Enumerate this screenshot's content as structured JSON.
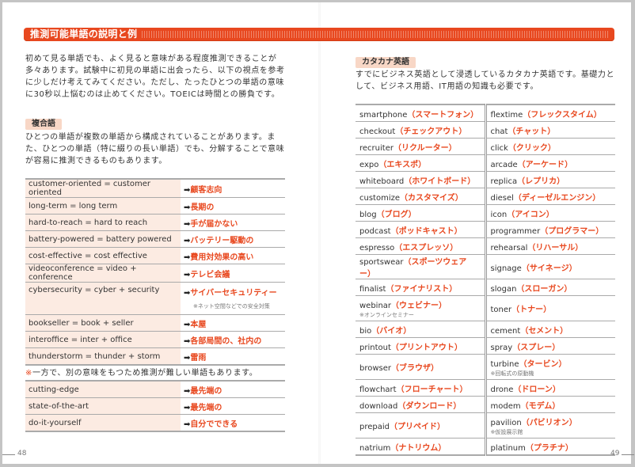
{
  "section_title": "推測可能単語の説明と例",
  "left_page": {
    "intro": "初めて見る単語でも、よく見ると意味がある程度推測できることが多々あります。試験中に初見の単語に出会ったら、以下の視点を参考に少しだけ考えてみてください。ただし、たったひとつの単語の意味に30秒以上悩むのは止めてください。TOEICは時間との勝負です。",
    "compound_tag": "複合語",
    "compound_desc": "ひとつの単語が複数の単語から構成されていることがあります。また、ひとつの単語（特に綴りの長い単語）でも、分解することで意味が容易に推測できるものもあります。",
    "compound_rows": [
      {
        "en": "customer-oriented = customer oriented",
        "jp": "顧客志向",
        "note": ""
      },
      {
        "en": "long-term = long term",
        "jp": "長期の",
        "note": ""
      },
      {
        "en": "hard-to-reach = hard to reach",
        "jp": "手が届かない",
        "note": ""
      },
      {
        "en": "battery-powered = battery powered",
        "jp": "バッテリー駆動の",
        "note": ""
      },
      {
        "en": "cost-effective = cost effective",
        "jp": "費用対効果の高い",
        "note": ""
      },
      {
        "en": "videoconference = video + conference",
        "jp": "テレビ会議",
        "note": ""
      },
      {
        "en": "cybersecurity = cyber + security",
        "jp": "サイバーセキュリティー",
        "note": "※ネット空間などでの安全対策"
      },
      {
        "en": "bookseller = book + seller",
        "jp": "本屋",
        "note": ""
      },
      {
        "en": "interoffice = inter + office",
        "jp": "各部局間の、社内の",
        "note": ""
      },
      {
        "en": "thunderstorm = thunder + storm",
        "jp": "雷雨",
        "note": ""
      }
    ],
    "arrow": "➡",
    "caution_mark": "※",
    "caution_text": "一方で、別の意味をもつため推測が難しい単語もあります。",
    "caution_rows": [
      {
        "en": "cutting-edge",
        "jp": "最先端の"
      },
      {
        "en": "state-of-the-art",
        "jp": "最先端の"
      },
      {
        "en": "do-it-yourself",
        "jp": "自分でできる"
      }
    ],
    "page_number": "48"
  },
  "right_page": {
    "katakana_tag": "カタカナ英語",
    "katakana_desc": "すでにビジネス英語として浸透しているカタカナ英語です。基礎力として、ビジネス用語、IT用語の知識も必要です。",
    "rows": [
      [
        {
          "en": "smartphone",
          "kana": "スマートフォン",
          "note": ""
        },
        {
          "en": "flextime",
          "kana": "フレックスタイム",
          "note": ""
        }
      ],
      [
        {
          "en": "checkout",
          "kana": "チェックアウト",
          "note": ""
        },
        {
          "en": "chat",
          "kana": "チャット",
          "note": ""
        }
      ],
      [
        {
          "en": "recruiter",
          "kana": "リクルーター",
          "note": ""
        },
        {
          "en": "click",
          "kana": "クリック",
          "note": ""
        }
      ],
      [
        {
          "en": "expo",
          "kana": "エキスポ",
          "note": ""
        },
        {
          "en": "arcade",
          "kana": "アーケード",
          "note": ""
        }
      ],
      [
        {
          "en": "whiteboard",
          "kana": "ホワイトボード",
          "note": ""
        },
        {
          "en": "replica",
          "kana": "レプリカ",
          "note": ""
        }
      ],
      [
        {
          "en": "customize",
          "kana": "カスタマイズ",
          "note": ""
        },
        {
          "en": "diesel",
          "kana": "ディーゼルエンジン",
          "note": ""
        }
      ],
      [
        {
          "en": "blog",
          "kana": "ブログ",
          "note": ""
        },
        {
          "en": "icon",
          "kana": "アイコン",
          "note": ""
        }
      ],
      [
        {
          "en": "podcast",
          "kana": "ポッドキャスト",
          "note": ""
        },
        {
          "en": "programmer",
          "kana": "プログラマー",
          "note": ""
        }
      ],
      [
        {
          "en": "espresso",
          "kana": "エスプレッソ",
          "note": ""
        },
        {
          "en": "rehearsal",
          "kana": "リハーサル",
          "note": ""
        }
      ],
      [
        {
          "en": "sportswear",
          "kana": "スポーツウェアー",
          "note": ""
        },
        {
          "en": "signage",
          "kana": "サイネージ",
          "note": ""
        }
      ],
      [
        {
          "en": "finalist",
          "kana": "ファイナリスト",
          "note": ""
        },
        {
          "en": "slogan",
          "kana": "スローガン",
          "note": ""
        }
      ],
      [
        {
          "en": "webinar",
          "kana": "ウェビナー",
          "note": "※オンラインセミナー"
        },
        {
          "en": "toner",
          "kana": "トナー",
          "note": ""
        }
      ],
      [
        {
          "en": "bio",
          "kana": "バイオ",
          "note": ""
        },
        {
          "en": "cement",
          "kana": "セメント",
          "note": ""
        }
      ],
      [
        {
          "en": "printout",
          "kana": "プリントアウト",
          "note": ""
        },
        {
          "en": "spray",
          "kana": "スプレー",
          "note": ""
        }
      ],
      [
        {
          "en": "browser",
          "kana": "ブラウザ",
          "note": ""
        },
        {
          "en": "turbine",
          "kana": "タービン",
          "note": "※回転式の原動機"
        }
      ],
      [
        {
          "en": "flowchart",
          "kana": "フローチャート",
          "note": ""
        },
        {
          "en": "drone",
          "kana": "ドローン",
          "note": ""
        }
      ],
      [
        {
          "en": "download",
          "kana": "ダウンロード",
          "note": ""
        },
        {
          "en": "modem",
          "kana": "モデム",
          "note": ""
        }
      ],
      [
        {
          "en": "prepaid",
          "kana": "プリペイド",
          "note": ""
        },
        {
          "en": "pavilion",
          "kana": "パビリオン",
          "note": "※仮設展示館"
        }
      ],
      [
        {
          "en": "natrium",
          "kana": "ナトリウム",
          "note": ""
        },
        {
          "en": "platinum",
          "kana": "プラチナ",
          "note": ""
        }
      ]
    ],
    "paren_open": "（",
    "paren_close": "）",
    "page_number": "49"
  },
  "colors": {
    "accent": "#e8481f",
    "tag_bg": "#f8d7c6",
    "row_bg": "#fcebe2"
  }
}
